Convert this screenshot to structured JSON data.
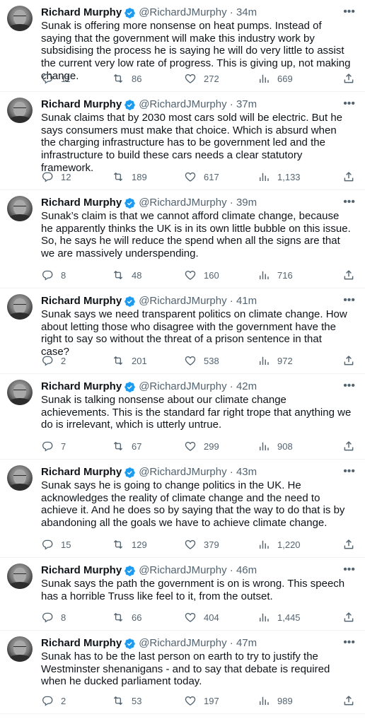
{
  "author": {
    "name": "Richard Murphy",
    "handle": "@RichardJMurphy"
  },
  "tweets": [
    {
      "time": "34m",
      "text": "Sunak is offering more nonsense on heat pumps. Instead of saying that the government will make this industry work by subsidising the process he is saying he will do very little to assist the current very low rate of progress. This is giving up, not making change.",
      "replies": "11",
      "retweets": "86",
      "likes": "272",
      "views": "669"
    },
    {
      "time": "37m",
      "text": "Sunak claims that by 2030 most cars sold will be electric. But he says consumers must make that choice. Which is absurd when the charging infrastructure has to be government led and the infrastructure to build these cars needs a clear statutory framework.",
      "replies": "12",
      "retweets": "189",
      "likes": "617",
      "views": "1,133"
    },
    {
      "time": "39m",
      "text": "Sunak’s claim is that we cannot afford climate change, because he apparently thinks the UK is in its own little bubble on this issue.  So, he says he will reduce the spend when all the signs are that we are massively underspending.",
      "replies": "8",
      "retweets": "48",
      "likes": "160",
      "views": "716"
    },
    {
      "time": "41m",
      "text": "Sunak says we need transparent politics on climate change. How about letting those who disagree with the government have the right to say so without the threat of a prison sentence in that case?",
      "replies": "2",
      "retweets": "201",
      "likes": "538",
      "views": "972"
    },
    {
      "time": "42m",
      "text": "Sunak is talking nonsense about our climate change achievements. This is the standard far right trope that anything we do is irrelevant, which is utterly untrue.",
      "replies": "7",
      "retweets": "67",
      "likes": "299",
      "views": "908"
    },
    {
      "time": "43m",
      "text": "Sunak says he is going to change politics in the UK. He acknowledges the reality of climate change and the need to achieve it. And he does so by saying that the way to do that is by abandoning all the goals we have to achieve climate change.",
      "replies": "15",
      "retweets": "129",
      "likes": "379",
      "views": "1,220"
    },
    {
      "time": "46m",
      "text": "Sunak says the path the government is on is wrong. This speech has a horrible Truss like feel to it, from the outset.",
      "replies": "8",
      "retweets": "66",
      "likes": "404",
      "views": "1,445"
    },
    {
      "time": "47m",
      "text": "Sunak has to be the last person on earth to try to justify the Westminster shenanigans - and to say that debate is required when he ducked parliament today.",
      "replies": "2",
      "retweets": "53",
      "likes": "197",
      "views": "989"
    }
  ],
  "icons": {
    "verified": "verified-badge-icon",
    "more": "more-dots-icon",
    "reply": "reply-icon",
    "retweet": "retweet-icon",
    "like": "heart-icon",
    "views": "views-chart-icon",
    "share": "share-icon"
  },
  "colors": {
    "verified": "#1d9bf0",
    "secondary": "#536471",
    "text": "#0f1419"
  }
}
